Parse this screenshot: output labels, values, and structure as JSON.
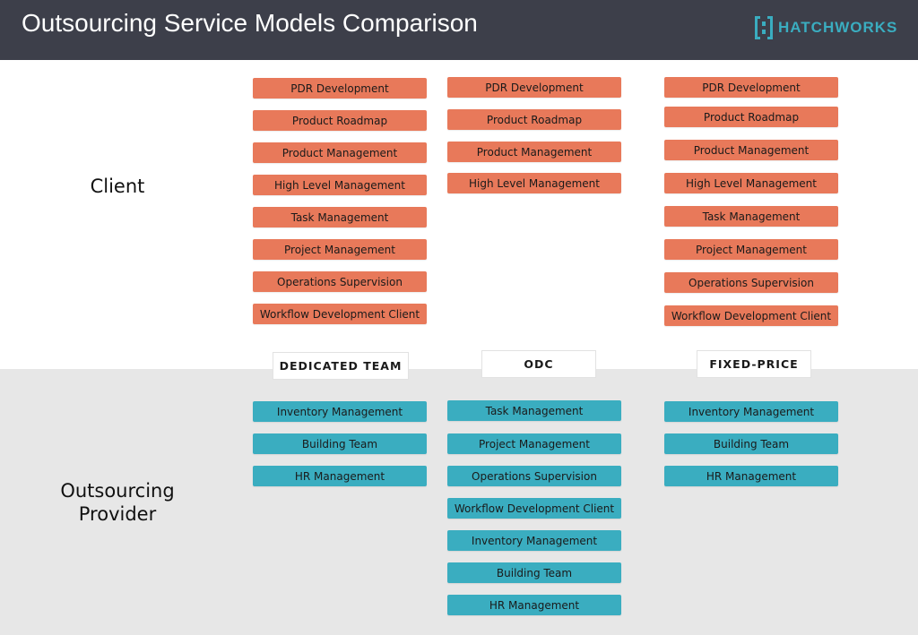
{
  "header": {
    "title": "Outsourcing Service Models Comparison",
    "logo_text": "HATCHWORKS"
  },
  "colors": {
    "header_bg": "#3d3f4a",
    "brand_teal": "#3aadc0",
    "client_task": "#e8795a",
    "provider_task": "#3aadc0",
    "provider_bg": "#e7e7e7"
  },
  "sections": {
    "client": "Client",
    "provider": "Outsourcing Provider"
  },
  "models": [
    {
      "name": "DEDICATED TEAM",
      "client_tasks": [
        "PDR Development",
        "Product Roadmap",
        "Product Management",
        "High Level Management",
        "Task Management",
        "Project Management",
        "Operations Supervision",
        "Workflow Development Client"
      ],
      "provider_tasks": [
        "Inventory Management",
        "Building Team",
        "HR Management"
      ]
    },
    {
      "name": "ODC",
      "client_tasks": [
        "PDR Development",
        "Product Roadmap",
        "Product Management",
        "High Level Management"
      ],
      "provider_tasks": [
        "Task Management",
        "Project Management",
        "Operations Supervision",
        "Workflow Development Client",
        "Inventory Management",
        "Building Team",
        "HR Management"
      ]
    },
    {
      "name": "FIXED-PRICE",
      "client_tasks": [
        "PDR Development",
        "Product Roadmap",
        "Product Management",
        "High Level Management",
        "Task Management",
        "Project Management",
        "Operations Supervision",
        "Workflow Development Client"
      ],
      "provider_tasks": [
        "Inventory Management",
        "Building Team",
        "HR Management"
      ]
    }
  ]
}
